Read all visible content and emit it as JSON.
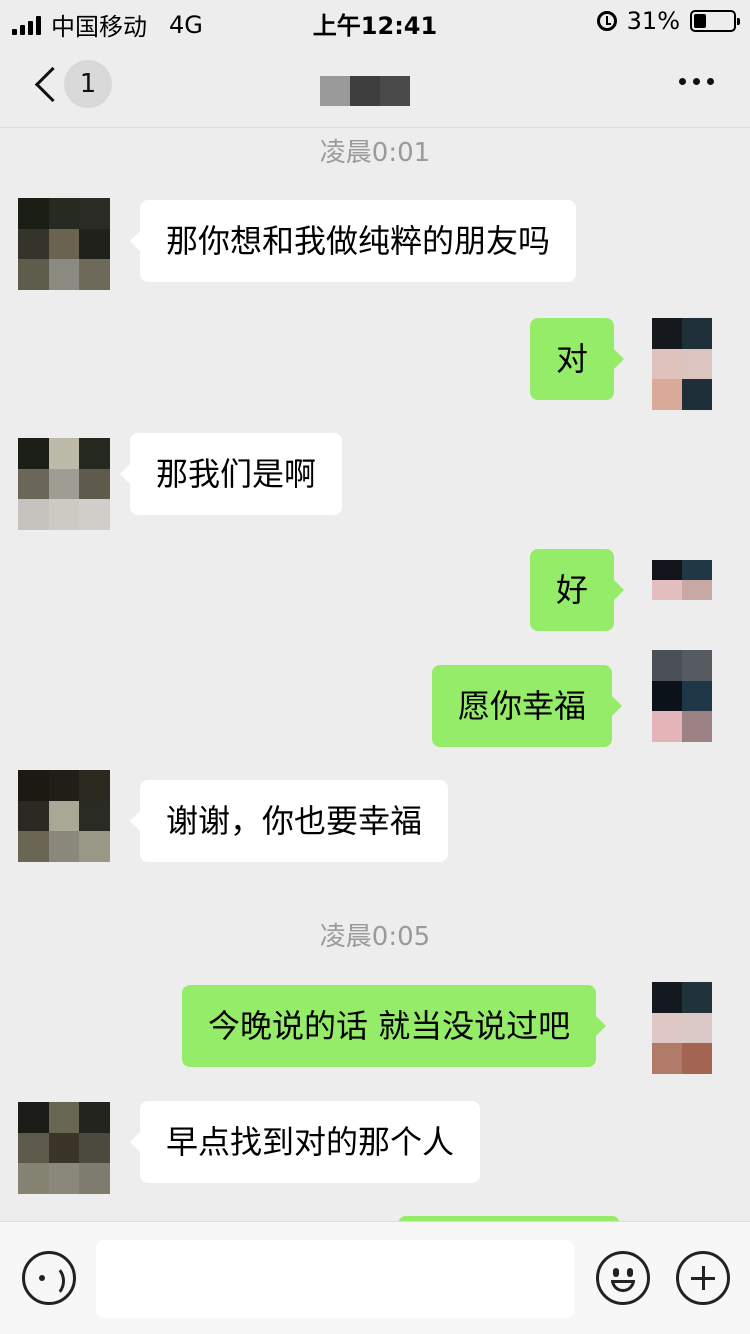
{
  "status_bar": {
    "carrier": "中国移动",
    "network": "4G",
    "time": "上午12:41",
    "battery_pct": "31%",
    "battery_level": 0.31
  },
  "nav": {
    "unread_count": "1",
    "title_mosaic_colors": [
      "#9a9a9a",
      "#3e3e3e",
      "#4a4a4a"
    ]
  },
  "colors": {
    "background": "#ededed",
    "outgoing_bubble": "#95ec69",
    "incoming_bubble": "#ffffff",
    "timestamp_text": "#9a9a9a"
  },
  "messages": {
    "ts1": "凌晨0:01",
    "m1": "那你想和我做纯粹的朋友吗",
    "m2": "对",
    "m3": "那我们是啊",
    "m4": "好",
    "m5": "愿你幸福",
    "m6": "谢谢，你也要幸福",
    "ts2": "凌晨0:05",
    "m7": "今晚说的话 就当没说过吧",
    "m8": "早点找到对的那个人"
  },
  "avatars": {
    "a1": [
      "#1a1d14",
      "#272a20",
      "#2a2b24",
      "#35342a",
      "#6a6350",
      "#1f211a",
      "#5e5d4b",
      "#8a8a80",
      "#6e6a5a"
    ],
    "a2": [
      "#15181d",
      "#203038",
      "#e0c2bd",
      "#dcc4c0",
      "#d9aa98",
      "#1f2f3a"
    ],
    "a3": [
      "#1c1f18",
      "#bcbaa8",
      "#25281f",
      "#6a6758",
      "#9e9d93",
      "#5e5b4d",
      "#c4c3be",
      "#cbcac3",
      "#cfcec8"
    ],
    "a4": [
      "#12151c",
      "#1f3846",
      "#e3bdbf",
      "#c7a8a2"
    ],
    "a5": [
      "#4b4f57",
      "#565b62",
      "#0b121a",
      "#1d3747",
      "#e4b5b8",
      "#9b8183"
    ],
    "a6": [
      "#1a1a12",
      "#1f1f17",
      "#2a2a21",
      "#2b2a22",
      "#a9a796",
      "#2a2b23",
      "#6b6653",
      "#8a887a",
      "#9a9987"
    ],
    "a7": [
      "#14191f",
      "#20323a",
      "#dfc7c6",
      "#dbc9c8",
      "#b17b6a",
      "#a36452"
    ],
    "a8": [
      "#1b1c17",
      "#676652",
      "#23241d",
      "#5d5a4c",
      "#3a3526",
      "#4a4a3e",
      "#858473",
      "#8a8878",
      "#7e7c6f"
    ]
  },
  "input": {
    "placeholder": ""
  },
  "icons": {
    "back": "chevron-left-icon",
    "more": "more-dots-icon",
    "voice": "voice-icon",
    "emoji": "emoji-icon",
    "plus": "plus-icon"
  }
}
